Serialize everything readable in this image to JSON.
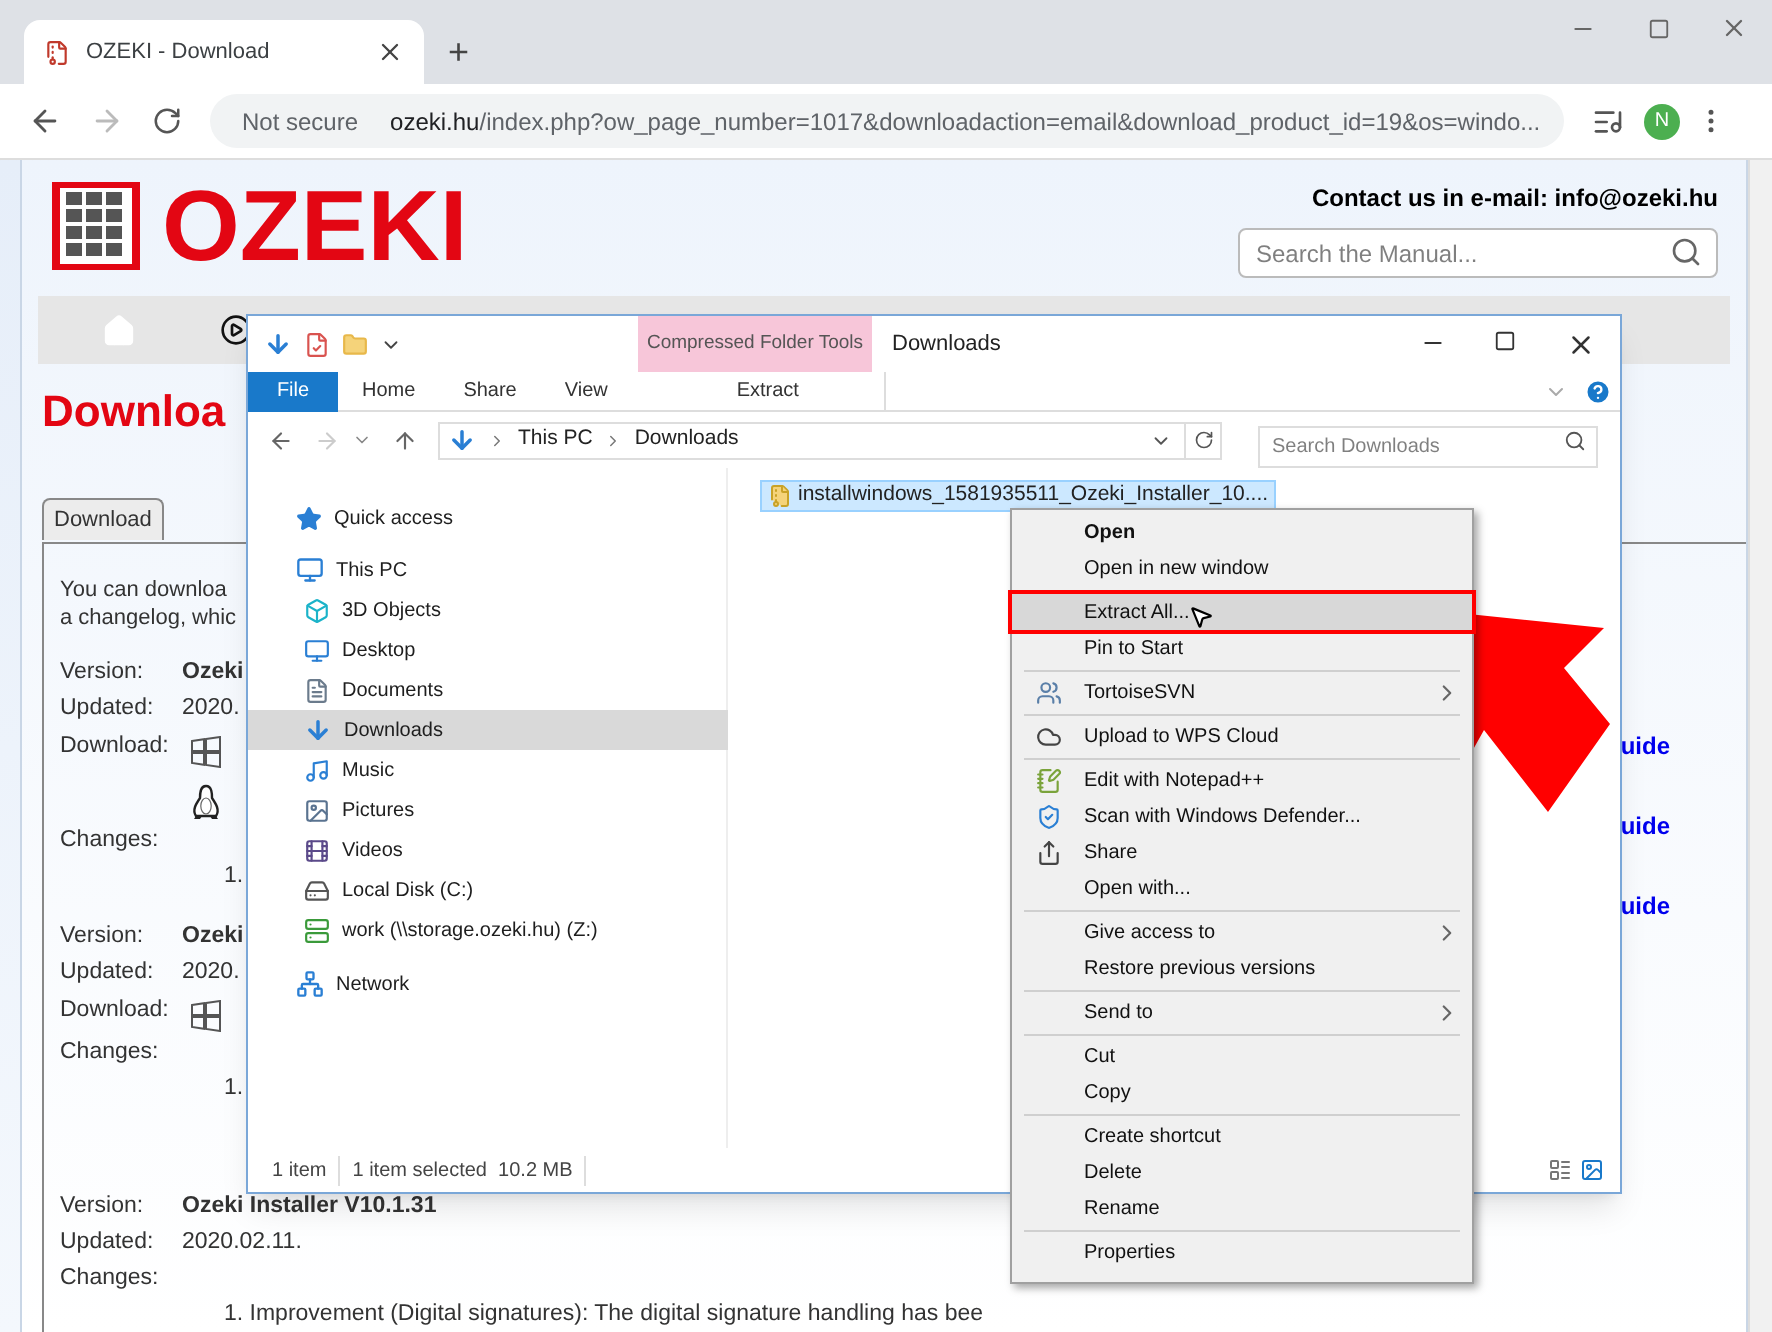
{
  "browser": {
    "tab_title": "OZEKI - Download",
    "new_tab": "+",
    "security": "Not secure",
    "url_host": "ozeki.hu",
    "url_path": "/index.php?ow_page_number=1017&downloadaction=email&download_product_id=19&os=windo...",
    "avatar": "N"
  },
  "page": {
    "logo": "OZEKI",
    "contact": "Contact us in e-mail: info@ozeki.hu",
    "search_placeholder": "Search the Manual...",
    "heading": "Downloa",
    "tab": "Download",
    "intro": [
      "You can downloa",
      "a changelog, whic"
    ],
    "releases": [
      {
        "version_label": "Version:",
        "version": "Ozeki",
        "updated_label": "Updated:",
        "updated": "2020.",
        "download_label": "Download:",
        "platforms": [
          {
            "kind": "windows"
          },
          {
            "kind": "linux"
          }
        ],
        "changes_label": "Changes:",
        "changes": [
          "1."
        ]
      },
      {
        "version_label": "Version:",
        "version": "Ozeki",
        "updated_label": "Updated:",
        "updated": "2020.",
        "download_label": "Download:",
        "platforms": [
          {
            "kind": "windows"
          }
        ],
        "changes_label": "Changes:",
        "changes": [
          "1."
        ]
      },
      {
        "version_label": "Version:",
        "version": "Ozeki Installer V10.1.31",
        "updated_label": "Updated:",
        "updated": "2020.02.11.",
        "changes_label": "Changes:",
        "changes": [
          "1. Improvement (Digital signatures): The digital signature handling has bee"
        ]
      }
    ],
    "guide_links": [
      "uide",
      "uide",
      "uide"
    ]
  },
  "explorer": {
    "context_tab": "Compressed Folder Tools",
    "title": "Downloads",
    "ribbon_tabs": [
      {
        "label": "File",
        "kind": "file"
      },
      {
        "label": "Home",
        "kind": "tab"
      },
      {
        "label": "Share",
        "kind": "tab"
      },
      {
        "label": "View",
        "kind": "tab"
      },
      {
        "label": "Extract",
        "kind": "context"
      }
    ],
    "breadcrumb": [
      "This PC",
      "Downloads"
    ],
    "search_placeholder": "Search Downloads",
    "nav_items": [
      {
        "label": "Quick access",
        "selected": false
      },
      {
        "label": "This PC",
        "selected": false,
        "children": [
          {
            "label": "3D Objects",
            "selected": false
          },
          {
            "label": "Desktop",
            "selected": false
          },
          {
            "label": "Documents",
            "selected": false
          },
          {
            "label": "Downloads",
            "selected": true
          },
          {
            "label": "Music",
            "selected": false
          },
          {
            "label": "Pictures",
            "selected": false
          },
          {
            "label": "Videos",
            "selected": false
          },
          {
            "label": "Local Disk (C:)",
            "selected": false
          },
          {
            "label": "work (\\\\storage.ozeki.hu) (Z:)",
            "selected": false
          }
        ]
      },
      {
        "label": "Network",
        "selected": false
      }
    ],
    "file": {
      "name": "installwindows_1581935511_Ozeki_Installer_10....",
      "selected": true
    },
    "status": [
      "1 item",
      "1 item selected  10.2 MB"
    ]
  },
  "context_menu": [
    {
      "kind": "item",
      "label": "Open",
      "default": true,
      "highlighted": false,
      "submenu": false
    },
    {
      "kind": "item",
      "label": "Open in new window",
      "default": false,
      "highlighted": false,
      "submenu": false
    },
    {
      "kind": "separator"
    },
    {
      "kind": "item",
      "label": "Extract All...",
      "default": false,
      "highlighted": true,
      "submenu": false
    },
    {
      "kind": "item",
      "label": "Pin to Start",
      "default": false,
      "highlighted": false,
      "submenu": false
    },
    {
      "kind": "separator"
    },
    {
      "kind": "item",
      "label": "TortoiseSVN",
      "default": false,
      "highlighted": false,
      "submenu": true
    },
    {
      "kind": "separator"
    },
    {
      "kind": "item",
      "label": "Upload to WPS Cloud",
      "default": false,
      "highlighted": false,
      "submenu": false
    },
    {
      "kind": "separator"
    },
    {
      "kind": "item",
      "label": "Edit with Notepad++",
      "default": false,
      "highlighted": false,
      "submenu": false
    },
    {
      "kind": "item",
      "label": "Scan with Windows Defender...",
      "default": false,
      "highlighted": false,
      "submenu": false
    },
    {
      "kind": "item",
      "label": "Share",
      "default": false,
      "highlighted": false,
      "submenu": false
    },
    {
      "kind": "item",
      "label": "Open with...",
      "default": false,
      "highlighted": false,
      "submenu": false
    },
    {
      "kind": "separator"
    },
    {
      "kind": "item",
      "label": "Give access to",
      "default": false,
      "highlighted": false,
      "submenu": true
    },
    {
      "kind": "item",
      "label": "Restore previous versions",
      "default": false,
      "highlighted": false,
      "submenu": false
    },
    {
      "kind": "separator"
    },
    {
      "kind": "item",
      "label": "Send to",
      "default": false,
      "highlighted": false,
      "submenu": true
    },
    {
      "kind": "separator"
    },
    {
      "kind": "item",
      "label": "Cut",
      "default": false,
      "highlighted": false,
      "submenu": false
    },
    {
      "kind": "item",
      "label": "Copy",
      "default": false,
      "highlighted": false,
      "submenu": false
    },
    {
      "kind": "separator"
    },
    {
      "kind": "item",
      "label": "Create shortcut",
      "default": false,
      "highlighted": false,
      "submenu": false
    },
    {
      "kind": "item",
      "label": "Delete",
      "default": false,
      "highlighted": false,
      "submenu": false
    },
    {
      "kind": "item",
      "label": "Rename",
      "default": false,
      "highlighted": false,
      "submenu": false
    },
    {
      "kind": "separator"
    },
    {
      "kind": "item",
      "label": "Properties",
      "default": false,
      "highlighted": false,
      "submenu": false
    }
  ]
}
